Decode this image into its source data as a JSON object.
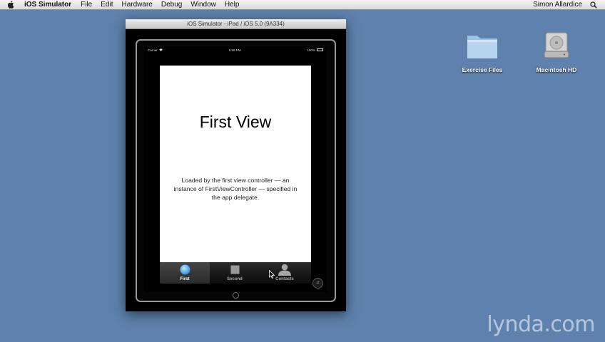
{
  "menubar": {
    "apple_icon": "apple-icon",
    "app_name": "iOS Simulator",
    "items": [
      "File",
      "Edit",
      "Hardware",
      "Debug",
      "Window",
      "Help"
    ],
    "user": "Simon Allardice",
    "search_icon": "spotlight-search-icon"
  },
  "desktop": {
    "icons": [
      {
        "label": "Exercise Files",
        "icon": "folder-icon"
      },
      {
        "label": "Macintosh HD",
        "icon": "hard-drive-icon"
      }
    ]
  },
  "simulator": {
    "title": "iOS Simulator - iPad / iOS 5.0 (9A334)",
    "status": {
      "carrier": "Carrier",
      "time": "5:56 PM",
      "battery": "100%"
    },
    "view": {
      "title": "First View",
      "description": "Loaded by the first view controller — an instance of FirstViewController — specified in the app delegate."
    },
    "tabs": [
      {
        "label": "First",
        "icon": "circle-icon",
        "selected": true
      },
      {
        "label": "Second",
        "icon": "square-icon",
        "selected": false
      },
      {
        "label": "Contacts",
        "icon": "contacts-icon",
        "selected": false
      }
    ],
    "rotate_icon": "rotation-lock-icon"
  },
  "watermark": "lynda.com",
  "colors": {
    "desktop": "#5e82ad",
    "window": "#000000",
    "content": "#ffffff"
  }
}
